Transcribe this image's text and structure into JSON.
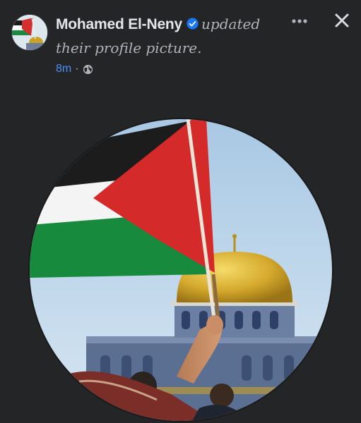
{
  "post": {
    "author_name": "Mohamed El-Neny",
    "action_line_1": "updated",
    "action_line_2": "their profile picture.",
    "timestamp": "8m",
    "separator": "·",
    "audience_icon": "globe-icon",
    "verified_icon": "verified-badge-icon"
  },
  "controls": {
    "more_icon": "more-horizontal-icon",
    "close_icon": "close-icon"
  },
  "colors": {
    "background": "#242526",
    "name": "#e4e6eb",
    "secondary_text": "#b0b3b8",
    "link": "#4e8ef7",
    "verified": "#1877f2"
  }
}
